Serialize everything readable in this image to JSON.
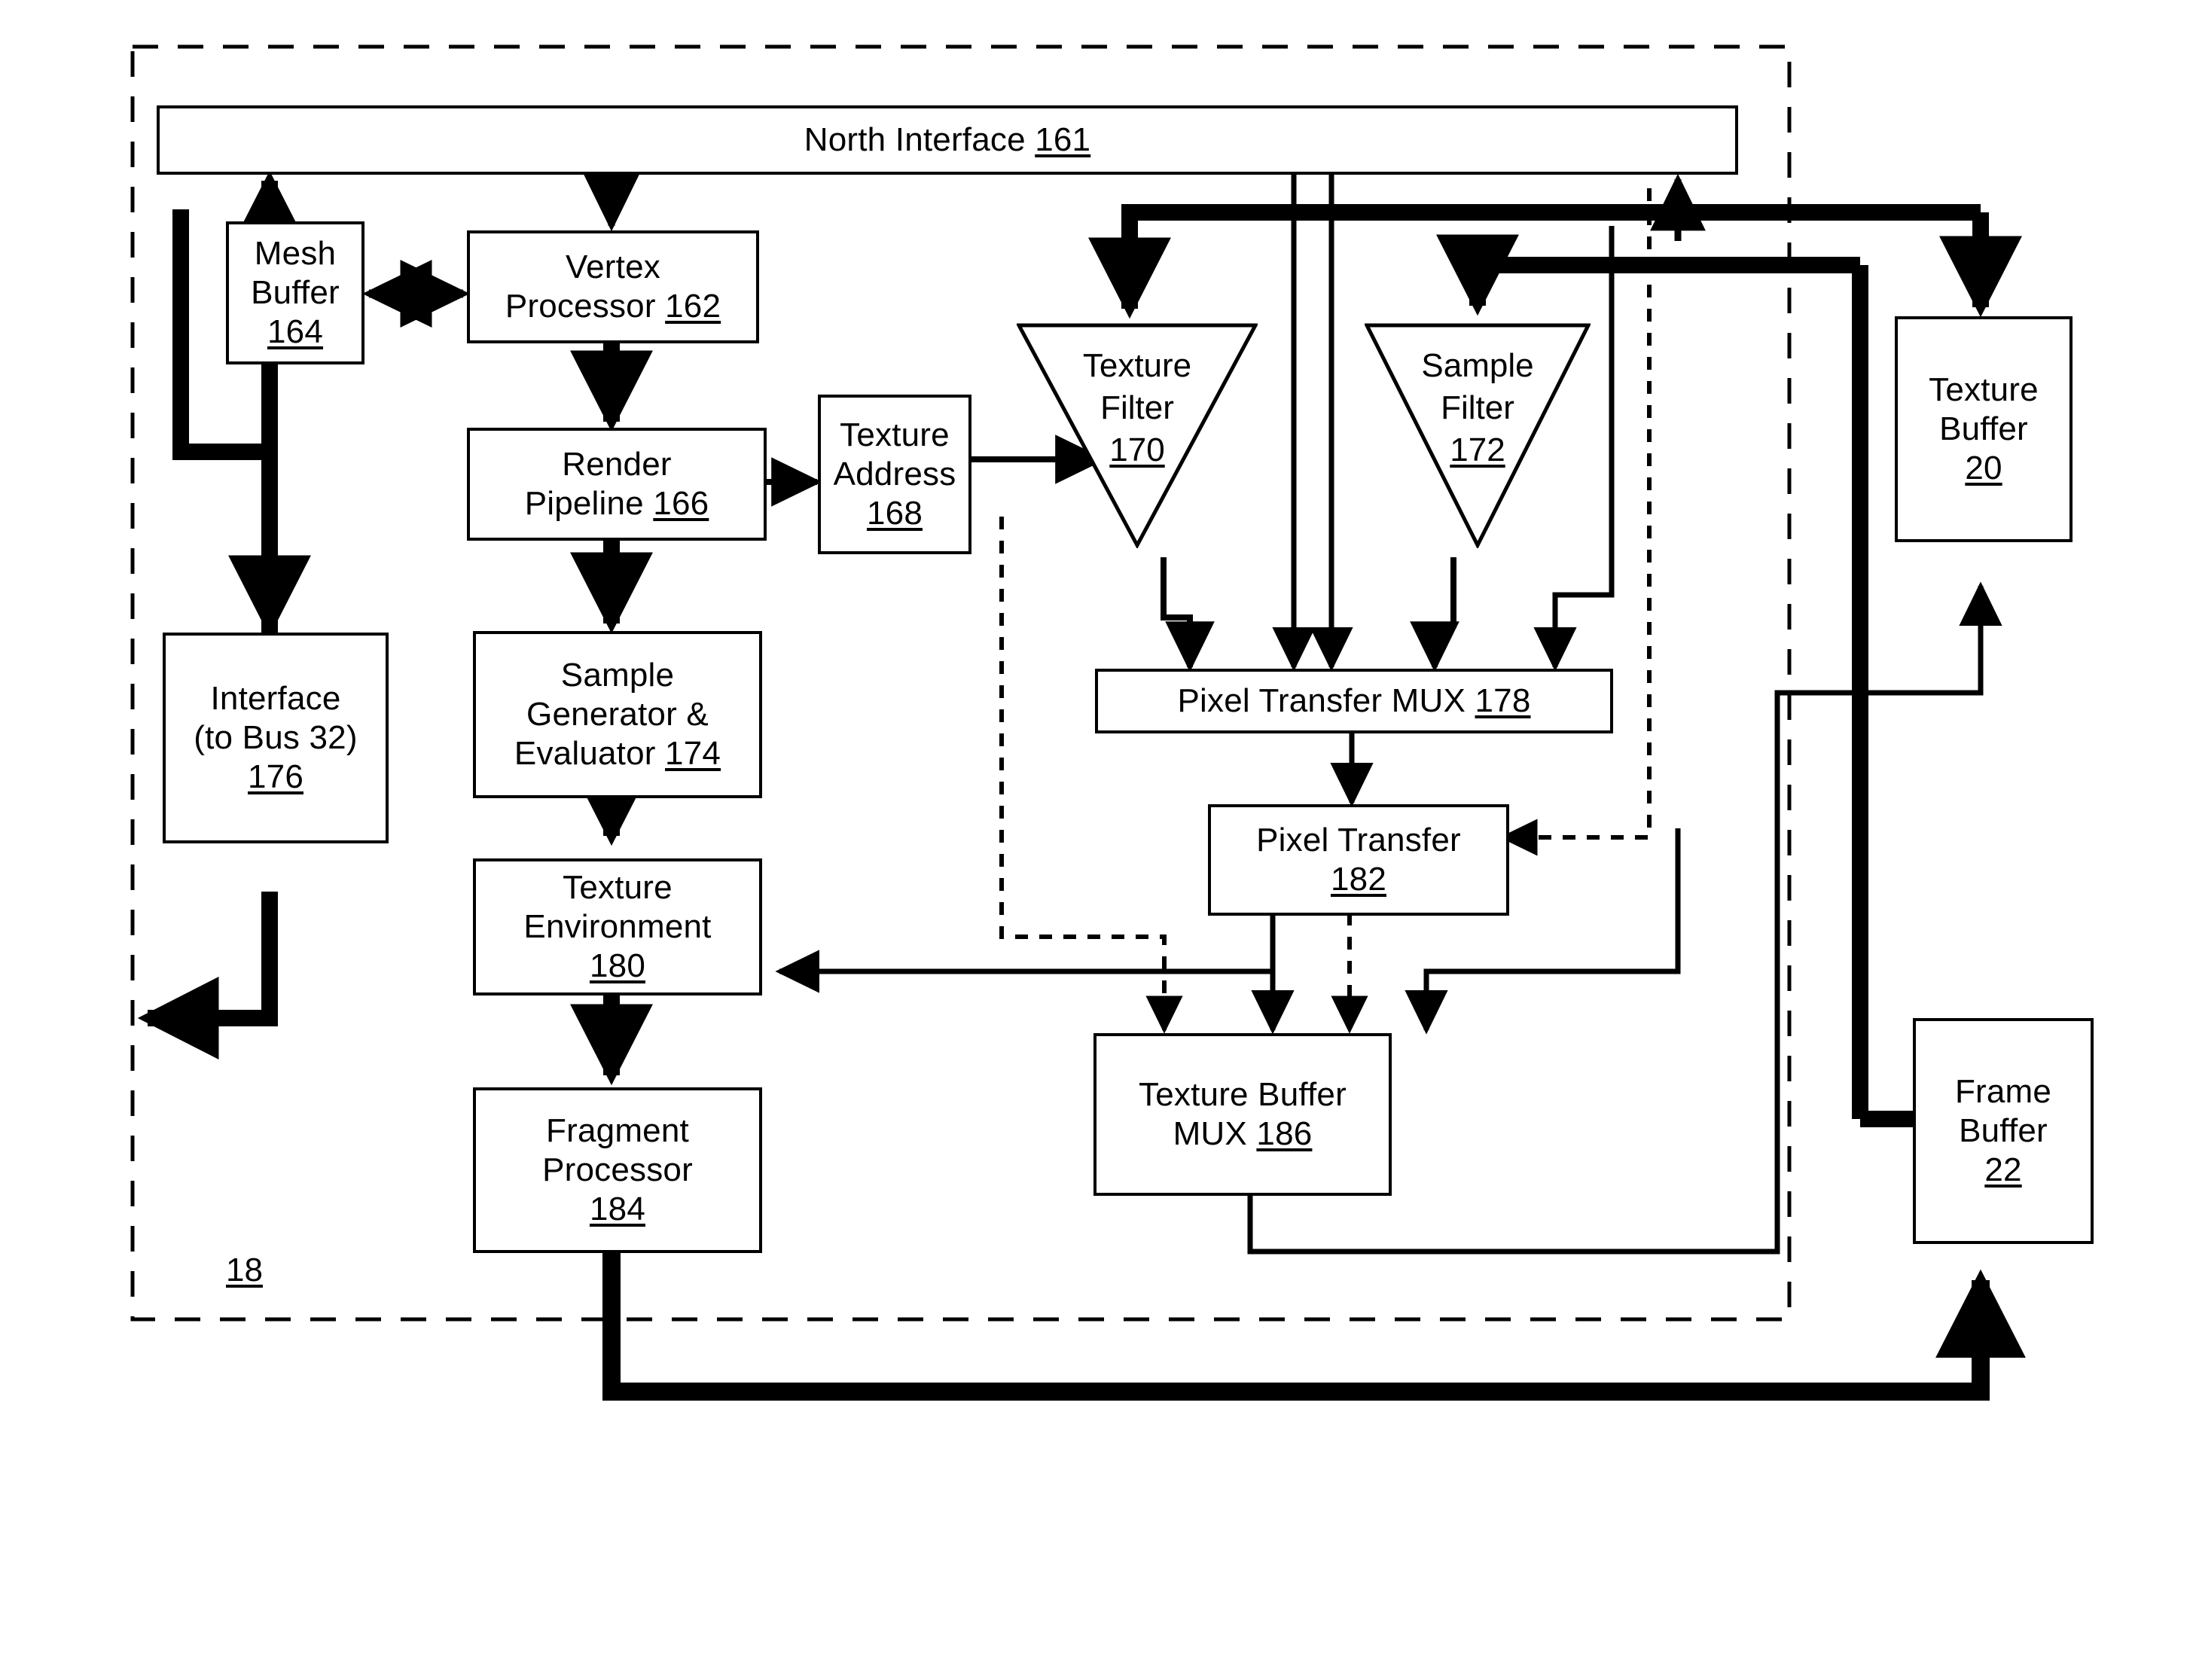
{
  "figure": {
    "type": "block-diagram",
    "boundary_label": "18",
    "boundary_style": "dashed"
  },
  "blocks": {
    "north_interface": {
      "title": "North Interface",
      "ref": "161"
    },
    "mesh_buffer": {
      "line1": "Mesh",
      "line2": "Buffer",
      "ref": "164"
    },
    "vertex_processor": {
      "line1": "Vertex",
      "line2": "Processor",
      "ref": "162"
    },
    "render_pipeline": {
      "line1": "Render",
      "line2": "Pipeline",
      "ref": "166"
    },
    "texture_address": {
      "line1": "Texture",
      "line2": "Address",
      "ref": "168"
    },
    "interface_bus": {
      "line1": "Interface",
      "line2": "(to Bus 32)",
      "ref": "176"
    },
    "sample_generator": {
      "line1": "Sample",
      "line2": "Generator &",
      "line3": "Evaluator",
      "ref": "174"
    },
    "texture_environment": {
      "line1": "Texture",
      "line2": "Environment",
      "ref": "180"
    },
    "fragment_processor": {
      "line1": "Fragment",
      "line2": "Processor",
      "ref": "184"
    },
    "texture_filter": {
      "line1": "Texture",
      "line2": "Filter",
      "ref": "170"
    },
    "sample_filter": {
      "line1": "Sample",
      "line2": "Filter",
      "ref": "172"
    },
    "pixel_transfer_mux": {
      "title": "Pixel Transfer MUX",
      "ref": "178"
    },
    "pixel_transfer": {
      "line1": "Pixel Transfer",
      "ref": "182"
    },
    "texture_buffer_mux": {
      "line1": "Texture Buffer",
      "line2": "MUX",
      "ref": "186"
    },
    "texture_buffer": {
      "line1": "Texture",
      "line2": "Buffer",
      "ref": "20"
    },
    "frame_buffer": {
      "line1": "Frame",
      "line2": "Buffer",
      "ref": "22"
    }
  },
  "colors": {
    "ink": "#000000",
    "paper": "#ffffff"
  }
}
